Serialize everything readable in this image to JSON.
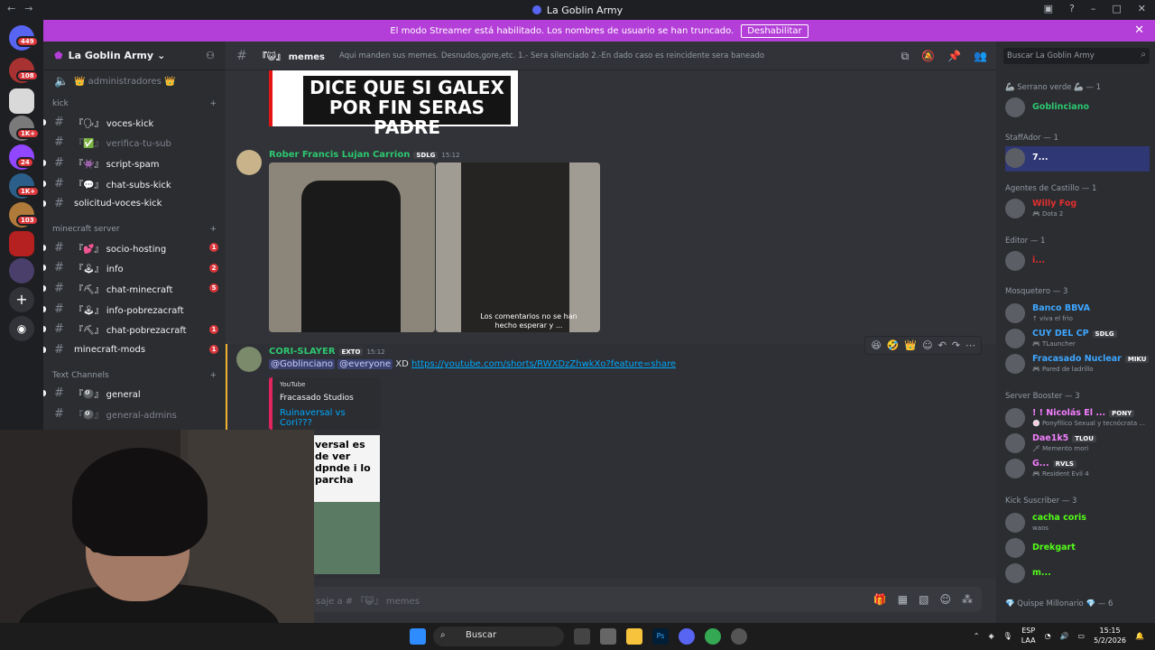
{
  "window": {
    "title": "La Goblin Army"
  },
  "banner": {
    "text": "El modo Streamer está habilitado. Los nombres de usuario se han truncado.",
    "button": "Deshabilitar"
  },
  "guilds": {
    "badges": [
      "449",
      "108",
      "1K+",
      "24",
      "1K+",
      "103"
    ]
  },
  "server": {
    "name": "La Goblin Army"
  },
  "sidebar": {
    "top_channel": "👑 administradores 👑",
    "categories": [
      {
        "label": "kick",
        "channels": [
          {
            "label": "『🗣』 voces-kick",
            "muted": false,
            "mention": null
          },
          {
            "label": "『✅』 verifica-tu-sub",
            "muted": true,
            "mention": null
          },
          {
            "label": "『👾』 script-spam",
            "muted": false,
            "mention": null
          },
          {
            "label": "『💬』 chat-subs-kick",
            "muted": false,
            "mention": null
          },
          {
            "label": "solicitud-voces-kick",
            "muted": false,
            "mention": null
          }
        ]
      },
      {
        "label": "minecraft server",
        "channels": [
          {
            "label": "『💕』 socio-hosting",
            "muted": false,
            "mention": "1"
          },
          {
            "label": "『🕹』 info",
            "muted": false,
            "mention": "2"
          },
          {
            "label": "『⛏』 chat-minecraft",
            "muted": false,
            "mention": "5"
          },
          {
            "label": "『🕹』 info-pobrezacraft",
            "muted": false,
            "mention": null
          },
          {
            "label": "『⛏』 chat-pobrezacraft",
            "muted": false,
            "mention": "1"
          },
          {
            "label": "minecraft-mods",
            "muted": false,
            "mention": "1"
          }
        ]
      },
      {
        "label": "Text Channels",
        "channels": [
          {
            "label": "『🎱』 general",
            "muted": false,
            "mention": null
          },
          {
            "label": "『🎱』 general-admins",
            "muted": true,
            "mention": null
          }
        ]
      }
    ]
  },
  "channel": {
    "name": "『😺』 memes",
    "topic": "Aqui manden sus memes. Desnudos,gore,etc. 1.- Sera silenciado 2.-En dado caso es reincidente sera baneado"
  },
  "messages": {
    "meme_image_text": "DICE QUE SI GALEX POR FIN SERAS PADRE",
    "msg1": {
      "author": "Rober Francis Lujan Carrion",
      "tag": "SDLG",
      "time": "15:12",
      "caption": "Los comentarios no se han hecho esperar y ..."
    },
    "msg2": {
      "author": "CORI-SLAYER",
      "tag": "EXTO",
      "time": "15:12",
      "mention1": "@Goblinciano",
      "mention2": "@everyone",
      "text": "XD",
      "link": "https://youtube.com/shorts/RWXDzZhwkXo?feature=share",
      "embed_provider": "YouTube",
      "embed_author": "Fracasado Studios",
      "embed_title": "Ruinaversal  vs Cori???",
      "thumb_text": "versal es de ver dpnde i lo parcha"
    }
  },
  "composer": {
    "placeholder": "saje a # 『😺』 memes"
  },
  "members": {
    "search_placeholder": "Buscar La Goblin Army",
    "groups": [
      {
        "label": "🦾 Serrano verde 🦾 — 1",
        "items": [
          {
            "name": "Goblinciano",
            "sub": "",
            "color": "#2dc770"
          }
        ]
      },
      {
        "label": "StaffAdor — 1",
        "items": [
          {
            "name": "7...",
            "sub": "",
            "color": "#ffffff"
          }
        ]
      },
      {
        "label": "Agentes de Castillo — 1",
        "items": [
          {
            "name": "Willy Fog",
            "sub": "🎮 Dota 2",
            "color": "#e22f2f"
          }
        ]
      },
      {
        "label": "Editor — 1",
        "items": [
          {
            "name": "i...",
            "sub": "",
            "color": "#e22f2f"
          }
        ]
      },
      {
        "label": "Mosquetero — 3",
        "items": [
          {
            "name": "Banco BBVA",
            "sub": "↑ viva el frio",
            "color": "#3ea6ff"
          },
          {
            "name": "CUY DEL CP",
            "sub": "🎮 TLauncher",
            "color": "#3ea6ff",
            "tag": "SDLG"
          },
          {
            "name": "Fracasado Nuclear",
            "sub": "🎮 Pared de ladrillo",
            "color": "#3ea6ff",
            "tag": "MIKU"
          }
        ]
      },
      {
        "label": "Server Booster — 3",
        "items": [
          {
            "name": "! ! Nicolás El ...",
            "sub": "🍥 Ponyfilico Sexual y tecnócrata ...",
            "color": "#f47fff",
            "tag": "PONY"
          },
          {
            "name": "Dae1k5",
            "sub": "🗡 Memento mori",
            "color": "#f47fff",
            "tag": "TLOU"
          },
          {
            "name": "G...",
            "sub": "🎮 Resident Evil 4",
            "color": "#f47fff",
            "tag": "RVLS"
          }
        ]
      },
      {
        "label": "Kick Suscriber — 3",
        "items": [
          {
            "name": "cacha coris",
            "sub": "waos",
            "color": "#53fc18"
          },
          {
            "name": "Drekgart",
            "sub": "",
            "color": "#53fc18"
          },
          {
            "name": "m...",
            "sub": "",
            "color": "#53fc18"
          }
        ]
      },
      {
        "label": "💎 Quispe Millonario 💎 — 6",
        "items": []
      }
    ]
  },
  "taskbar": {
    "search": "Buscar",
    "lang": "ESP",
    "lang_sub": "LAA",
    "time": "15:15",
    "date": "5/2/2026"
  }
}
